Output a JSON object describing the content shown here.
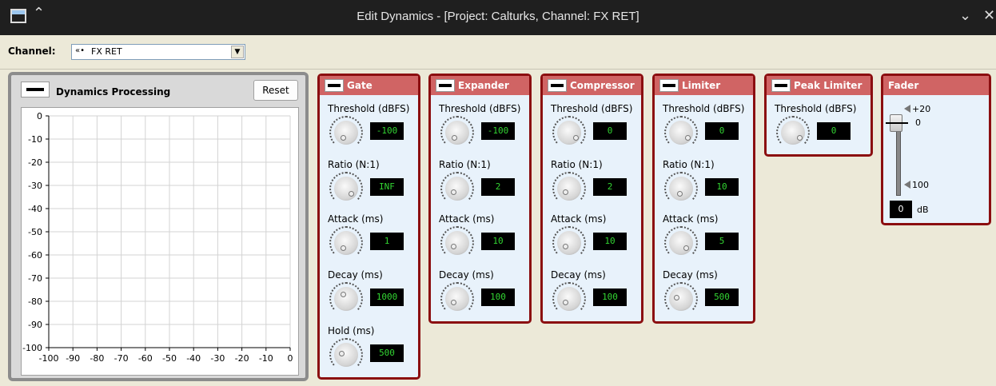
{
  "window": {
    "title": "Edit Dynamics - [Project: Calturks, Channel: FX RET]",
    "shade_icon": "double-chevron-up-icon",
    "minimize_icon": "chevron-down-icon",
    "close_icon": "close-icon"
  },
  "channel": {
    "label": "Channel:",
    "selected": "FX RET",
    "icon": "«•"
  },
  "dynamics": {
    "title": "Dynamics Processing",
    "reset_label": "Reset",
    "y_ticks": [
      "0",
      "-10",
      "-20",
      "-30",
      "-40",
      "-50",
      "-60",
      "-70",
      "-80",
      "-90",
      "-100"
    ],
    "x_ticks": [
      "-100",
      "-90",
      "-80",
      "-70",
      "-60",
      "-50",
      "-40",
      "-30",
      "-20",
      "-10",
      "0"
    ]
  },
  "panels": {
    "gate": {
      "title": "Gate",
      "threshold_label": "Threshold (dBFS)",
      "threshold": "-100",
      "ratio_label": "Ratio (N:1)",
      "ratio": "INF",
      "attack_label": "Attack (ms)",
      "attack": "1",
      "decay_label": "Decay (ms)",
      "decay": "1000",
      "hold_label": "Hold (ms)",
      "hold": "500"
    },
    "expander": {
      "title": "Expander",
      "threshold_label": "Threshold (dBFS)",
      "threshold": "-100",
      "ratio_label": "Ratio (N:1)",
      "ratio": "2",
      "attack_label": "Attack (ms)",
      "attack": "10",
      "decay_label": "Decay (ms)",
      "decay": "100"
    },
    "compressor": {
      "title": "Compressor",
      "threshold_label": "Threshold (dBFS)",
      "threshold": "0",
      "ratio_label": "Ratio (N:1)",
      "ratio": "2",
      "attack_label": "Attack (ms)",
      "attack": "10",
      "decay_label": "Decay (ms)",
      "decay": "100"
    },
    "limiter": {
      "title": "Limiter",
      "threshold_label": "Threshold (dBFS)",
      "threshold": "0",
      "ratio_label": "Ratio (N:1)",
      "ratio": "10",
      "attack_label": "Attack (ms)",
      "attack": "5",
      "decay_label": "Decay (ms)",
      "decay": "500"
    },
    "peak_limiter": {
      "title": "Peak Limiter",
      "threshold_label": "Threshold (dBFS)",
      "threshold": "0"
    },
    "fader": {
      "title": "Fader",
      "top_mark": "+20",
      "zero_mark": "0",
      "bottom_mark": "100",
      "value": "0",
      "unit": "dB"
    }
  }
}
